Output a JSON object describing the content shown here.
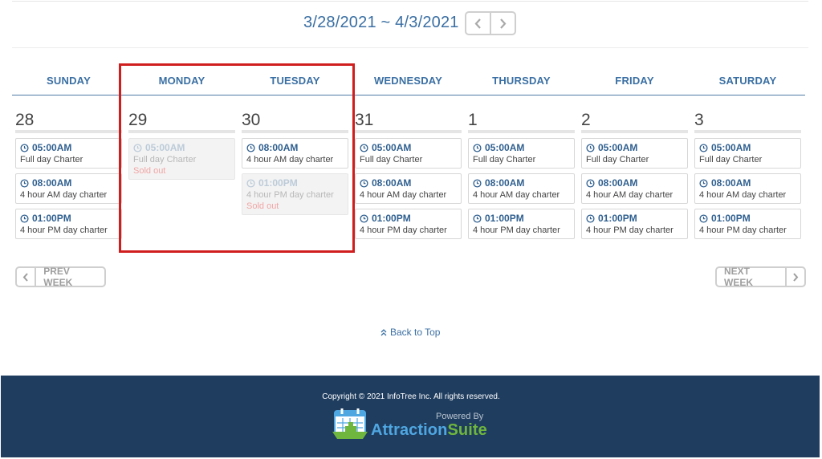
{
  "header": {
    "week_range": "3/28/2021 ~ 4/3/2021",
    "prev_icon": "chevron-left-icon",
    "next_icon": "chevron-right-icon"
  },
  "days": [
    {
      "name": "SUNDAY",
      "date": "28",
      "slots": [
        {
          "time": "05:00AM",
          "desc": "Full day Charter"
        },
        {
          "time": "08:00AM",
          "desc": "4 hour AM day charter"
        },
        {
          "time": "01:00PM",
          "desc": "4 hour PM day charter"
        }
      ]
    },
    {
      "name": "MONDAY",
      "date": "29",
      "slots": [
        {
          "time": "05:00AM",
          "desc": "Full day Charter",
          "status": "Sold out"
        }
      ]
    },
    {
      "name": "TUESDAY",
      "date": "30",
      "slots": [
        {
          "time": "08:00AM",
          "desc": "4 hour AM day charter"
        },
        {
          "time": "01:00PM",
          "desc": "4 hour PM day charter",
          "status": "Sold out"
        }
      ]
    },
    {
      "name": "WEDNESDAY",
      "date": "31",
      "slots": [
        {
          "time": "05:00AM",
          "desc": "Full day Charter"
        },
        {
          "time": "08:00AM",
          "desc": "4 hour AM day charter"
        },
        {
          "time": "01:00PM",
          "desc": "4 hour PM day charter"
        }
      ]
    },
    {
      "name": "THURSDAY",
      "date": "1",
      "slots": [
        {
          "time": "05:00AM",
          "desc": "Full day Charter"
        },
        {
          "time": "08:00AM",
          "desc": "4 hour AM day charter"
        },
        {
          "time": "01:00PM",
          "desc": "4 hour PM day charter"
        }
      ]
    },
    {
      "name": "FRIDAY",
      "date": "2",
      "slots": [
        {
          "time": "05:00AM",
          "desc": "Full day Charter"
        },
        {
          "time": "08:00AM",
          "desc": "4 hour AM day charter"
        },
        {
          "time": "01:00PM",
          "desc": "4 hour PM day charter"
        }
      ]
    },
    {
      "name": "SATURDAY",
      "date": "3",
      "slots": [
        {
          "time": "05:00AM",
          "desc": "Full day Charter"
        },
        {
          "time": "08:00AM",
          "desc": "4 hour AM day charter"
        },
        {
          "time": "01:00PM",
          "desc": "4 hour PM day charter"
        }
      ]
    }
  ],
  "pager": {
    "prev_label": "PREV WEEK",
    "next_label": "NEXT WEEK"
  },
  "back_to_top": "Back to Top",
  "footer": {
    "copyright": "Copyright © 2021 InfoTree Inc. All rights reserved.",
    "powered_by": "Powered By",
    "brand_part1": "Attraction",
    "brand_part2": "Suite"
  },
  "colors": {
    "accent": "#3a6fa3",
    "footer_bg": "#1f3d5f",
    "highlight": "#d01d1d",
    "sold_out": "#f2a5a5",
    "brand_blue": "#4fa7e2",
    "brand_green": "#6fb63e"
  }
}
